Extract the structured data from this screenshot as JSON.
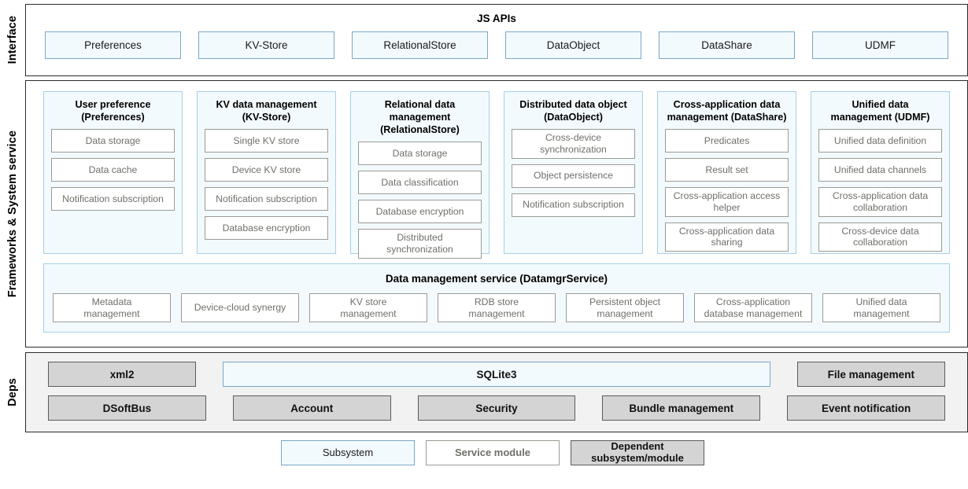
{
  "layers": {
    "interface": {
      "side_label": "Interface",
      "title": "JS APIs",
      "apis": [
        {
          "label": "Preferences"
        },
        {
          "label": "KV-Store"
        },
        {
          "label": "RelationalStore"
        },
        {
          "label": "DataObject"
        },
        {
          "label": "DataShare"
        },
        {
          "label": "UDMF"
        }
      ]
    },
    "frameworks": {
      "side_label": "Frameworks & System service",
      "modules": [
        {
          "title": "User preference\n(Preferences)",
          "items": [
            "Data storage",
            "Data cache",
            "Notification subscription"
          ]
        },
        {
          "title": "KV data management\n(KV-Store)",
          "items": [
            "Single KV store",
            "Device KV store",
            "Notification subscription",
            "Database encryption"
          ]
        },
        {
          "title": "Relational data\nmanagement\n(RelationalStore)",
          "items": [
            "Data storage",
            "Data classification",
            "Database encryption",
            "Distributed\nsynchronization"
          ]
        },
        {
          "title": "Distributed data object\n(DataObject)",
          "items": [
            "Cross-device\nsynchronization",
            "Object persistence",
            "Notification subscription"
          ]
        },
        {
          "title": "Cross-application data\nmanagement (DataShare)",
          "items": [
            "Predicates",
            "Result set",
            "Cross-application access\nhelper",
            "Cross-application data\nsharing"
          ]
        },
        {
          "title": "Unified data\nmanagement (UDMF)",
          "items": [
            "Unified data definition",
            "Unified data channels",
            "Cross-application data\ncollaboration",
            "Cross-device data\ncollaboration"
          ]
        }
      ],
      "data_management_service": {
        "title": "Data management service (DatamgrService)",
        "items": [
          "Metadata\nmanagement",
          "Device-cloud synergy",
          "KV store\nmanagement",
          "RDB store\nmanagement",
          "Persistent object\nmanagement",
          "Cross-application\ndatabase management",
          "Unified data\nmanagement"
        ]
      }
    },
    "deps": {
      "side_label": "Deps",
      "row1": [
        {
          "label": "xml2",
          "kind": "dependent",
          "flex": 1
        },
        {
          "label": "SQLite3",
          "kind": "subsystem",
          "flex": 3.72
        },
        {
          "label": "File management",
          "kind": "dependent",
          "flex": 1
        }
      ],
      "row2": [
        {
          "label": "DSoftBus",
          "kind": "dependent",
          "flex": 1
        },
        {
          "label": "Account",
          "kind": "dependent",
          "flex": 1
        },
        {
          "label": "Security",
          "kind": "dependent",
          "flex": 1
        },
        {
          "label": "Bundle management",
          "kind": "dependent",
          "flex": 1
        },
        {
          "label": "Event notification",
          "kind": "dependent",
          "flex": 1
        }
      ]
    }
  },
  "legend": [
    {
      "label": "Subsystem",
      "kind": "subsystem"
    },
    {
      "label": "Service module",
      "kind": "service"
    },
    {
      "label": "Dependent\nsubsystem/module",
      "kind": "dependent"
    }
  ],
  "colors": {
    "subsystem_fill": "#f2fafd",
    "subsystem_border": "#7aa7c7",
    "service_border": "#9b9b95",
    "service_text": "#6f6f6a",
    "dependent_fill": "#d4d4d4",
    "dependent_border": "#5c5c5c",
    "deps_band_fill": "#f2f2f2",
    "outer_border": "#2b2b2b"
  }
}
